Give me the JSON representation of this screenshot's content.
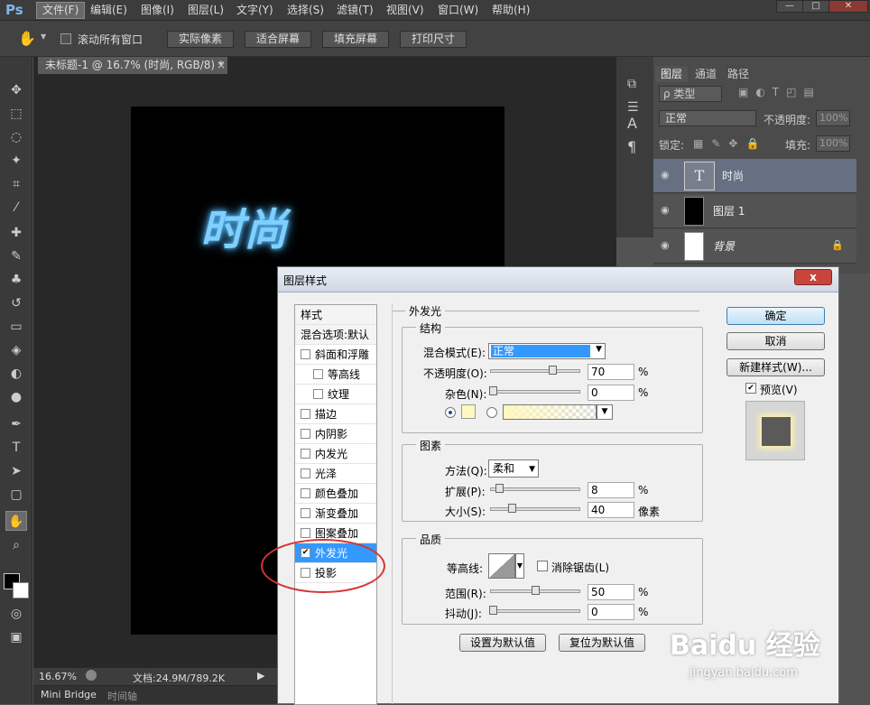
{
  "app": {
    "logo": "Ps"
  },
  "menu": [
    "文件(F)",
    "编辑(E)",
    "图像(I)",
    "图层(L)",
    "文字(Y)",
    "选择(S)",
    "滤镜(T)",
    "视图(V)",
    "窗口(W)",
    "帮助(H)"
  ],
  "window_controls": {
    "minimize": "—",
    "restore": "□",
    "close": "✕"
  },
  "options": {
    "scroll_all": "滚动所有窗口",
    "buttons": [
      "实际像素",
      "适合屏幕",
      "填充屏幕",
      "打印尺寸"
    ]
  },
  "document": {
    "tab": "未标题-1 @ 16.7% (时尚, RGB/8) *",
    "close": "×",
    "canvas_text": "时尚"
  },
  "status": {
    "zoom": "16.67%",
    "doc": "文档:24.9M/789.2K"
  },
  "bottom_tabs": [
    "Mini Bridge",
    "时间轴"
  ],
  "layers_panel": {
    "tabs": [
      "图层",
      "通道",
      "路径"
    ],
    "filter": "ρ 类型",
    "blend": "正常",
    "opacity_label": "不透明度:",
    "opacity": "100%",
    "lock_label": "锁定:",
    "fill_label": "填充:",
    "fill": "100%",
    "layers": [
      {
        "name": "时尚",
        "thumb": "T"
      },
      {
        "name": "图层 1"
      },
      {
        "name": "背景"
      }
    ]
  },
  "dialog": {
    "title": "图层样式",
    "close": "x",
    "styles_header": "样式",
    "blend_options": "混合选项:默认",
    "style_items": [
      {
        "label": "斜面和浮雕",
        "checked": false,
        "indent": false
      },
      {
        "label": "等高线",
        "checked": false,
        "indent": true
      },
      {
        "label": "纹理",
        "checked": false,
        "indent": true
      },
      {
        "label": "描边",
        "checked": false,
        "indent": false
      },
      {
        "label": "内阴影",
        "checked": false,
        "indent": false
      },
      {
        "label": "内发光",
        "checked": false,
        "indent": false
      },
      {
        "label": "光泽",
        "checked": false,
        "indent": false
      },
      {
        "label": "颜色叠加",
        "checked": false,
        "indent": false
      },
      {
        "label": "渐变叠加",
        "checked": false,
        "indent": false
      },
      {
        "label": "图案叠加",
        "checked": false,
        "indent": false
      },
      {
        "label": "外发光",
        "checked": true,
        "indent": false
      },
      {
        "label": "投影",
        "checked": false,
        "indent": false
      }
    ],
    "section_title": "外发光",
    "structure": {
      "title": "结构",
      "blend_mode_label": "混合模式(E):",
      "blend_mode": "正常",
      "opacity_label": "不透明度(O):",
      "opacity": "70",
      "noise_label": "杂色(N):",
      "noise": "0",
      "unit": "%",
      "glow_color": "#fff8c0"
    },
    "elements": {
      "title": "图素",
      "method_label": "方法(Q):",
      "method": "柔和",
      "spread_label": "扩展(P):",
      "spread": "8",
      "size_label": "大小(S):",
      "size": "40",
      "unit_pct": "%",
      "unit_px": "像素"
    },
    "quality": {
      "title": "品质",
      "contour_label": "等高线:",
      "antialias_label": "消除锯齿(L)",
      "range_label": "范围(R):",
      "range": "50",
      "jitter_label": "抖动(J):",
      "jitter": "0",
      "unit": "%"
    },
    "buttons": {
      "set_default": "设置为默认值",
      "reset_default": "复位为默认值",
      "ok": "确定",
      "cancel": "取消",
      "new_style": "新建样式(W)...",
      "preview": "预览(V)"
    }
  },
  "watermark": {
    "brand": "Baidu 经验",
    "url": "jingyan.baidu.com"
  }
}
